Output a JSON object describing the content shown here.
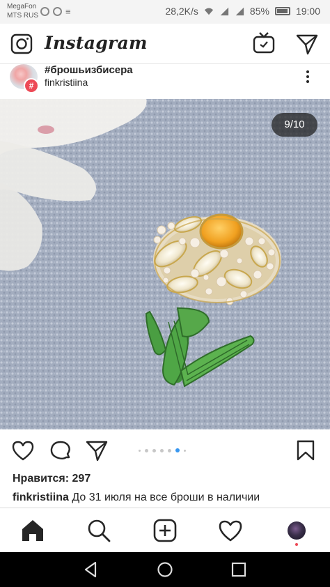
{
  "status_bar": {
    "carrier_line1": "MegaFon",
    "carrier_line2": "MTS RUS",
    "speed": "28,2K/s",
    "battery": "85%",
    "time": "19:00"
  },
  "app": {
    "title": "Instagram",
    "icons": [
      "camera-icon",
      "igtv-icon",
      "direct-message-icon"
    ]
  },
  "post": {
    "hashtag": "#брошьизбисера",
    "username": "finkristiina",
    "counter": "9/10",
    "dots_total": 7,
    "dots_active_index": 5,
    "likes": "Нравится: 297",
    "caption_user": "finkristiina",
    "caption_text": " До 31 июля на все броши в наличии"
  },
  "colors": {
    "accent_blue": "#3897f0",
    "badge_red": "#ed4956",
    "text": "#262626"
  },
  "bottom_nav": [
    "home-icon",
    "search-icon",
    "add-post-icon",
    "activity-heart-icon",
    "profile-avatar"
  ],
  "system_nav": [
    "back-icon",
    "home-circle-icon",
    "recents-square-icon"
  ]
}
